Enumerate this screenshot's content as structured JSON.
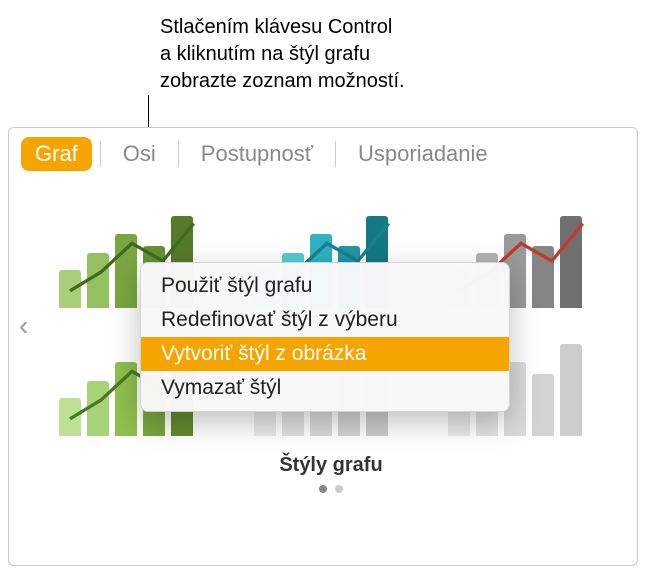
{
  "callout": {
    "line1": "Stlačením klávesu Control",
    "line2": "a kliknutím na štýl grafu",
    "line3": "zobrazte zoznam možností."
  },
  "tabs": {
    "chart": "Graf",
    "axes": "Osi",
    "series": "Postupnosť",
    "arrange": "Usporiadanie"
  },
  "styles": {
    "section_title": "Štýly grafu",
    "nav_prev": "‹",
    "thumbs": [
      {
        "bars": "#7aa63f",
        "line": "#3f6b1f"
      },
      {
        "bars": "#2db2c4",
        "line": "#1a7f8e"
      },
      {
        "bars": "#8a8a8a",
        "line": "#c0392b"
      },
      {
        "bars": "#8fbf4d",
        "line": "#4a7a1f"
      },
      {
        "bars": "#bdbdbd",
        "line": "#888888"
      },
      {
        "bars": "#bdbdbd",
        "line": "#888888"
      }
    ]
  },
  "context_menu": {
    "apply": "Použiť štýl grafu",
    "redefine": "Redefinovať štýl z výberu",
    "create_from_image": "Vytvoriť štýl z obrázka",
    "delete": "Vymazať štýl"
  }
}
